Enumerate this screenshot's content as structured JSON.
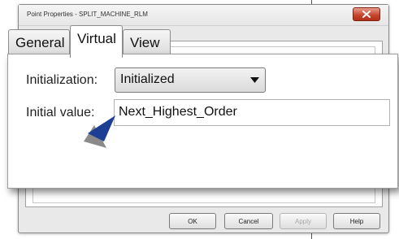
{
  "window": {
    "title": "Point Properties - SPLIT_MACHINE_RLM"
  },
  "tabs": [
    {
      "label": "General",
      "active": false
    },
    {
      "label": "Virtual",
      "active": true
    },
    {
      "label": "View",
      "active": false
    }
  ],
  "form": {
    "initialization_label": "Initialization:",
    "initialization_value": "Initialized",
    "initial_value_label": "Initial value:",
    "initial_value": "Next_Highest_Order"
  },
  "buttons": {
    "ok": "OK",
    "cancel": "Cancel",
    "apply": "Apply",
    "help": "Help"
  },
  "colors": {
    "pointer": "#1c3f94",
    "close_button": "#c4432b"
  },
  "icons": {
    "close": "close-icon",
    "dropdown": "chevron-down-icon",
    "pointer": "arrow-pointer-icon"
  }
}
